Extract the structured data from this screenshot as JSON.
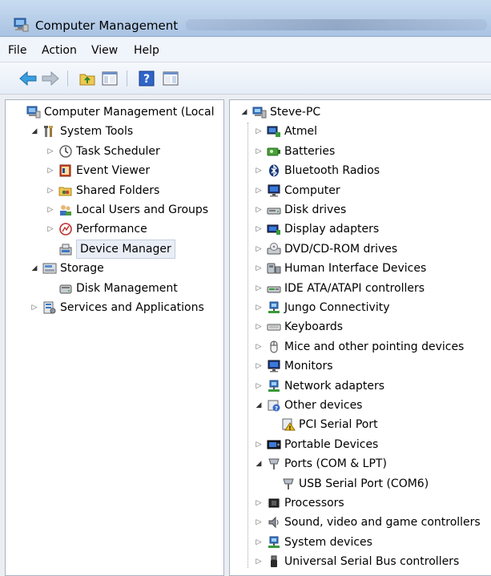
{
  "window": {
    "title": "Computer Management"
  },
  "menu": [
    "File",
    "Action",
    "View",
    "Help"
  ],
  "toolbar": {
    "buttons": [
      "back-icon",
      "forward-icon",
      "up-folder-icon",
      "show-hide-tree-icon",
      "help-icon",
      "properties-icon"
    ]
  },
  "left_tree": [
    {
      "label": "Computer Management (Local",
      "icon": "computer-management-icon",
      "level": 0,
      "expander": ""
    },
    {
      "label": "System Tools",
      "icon": "system-tools-icon",
      "level": 1,
      "expander": "open"
    },
    {
      "label": "Task Scheduler",
      "icon": "clock-icon",
      "level": 2,
      "expander": "closed"
    },
    {
      "label": "Event Viewer",
      "icon": "event-viewer-icon",
      "level": 2,
      "expander": "closed"
    },
    {
      "label": "Shared Folders",
      "icon": "shared-folders-icon",
      "level": 2,
      "expander": "closed"
    },
    {
      "label": "Local Users and Groups",
      "icon": "users-icon",
      "level": 2,
      "expander": "closed"
    },
    {
      "label": "Performance",
      "icon": "performance-icon",
      "level": 2,
      "expander": "closed"
    },
    {
      "label": "Device Manager",
      "icon": "device-manager-icon",
      "level": 2,
      "expander": "",
      "selected": true
    },
    {
      "label": "Storage",
      "icon": "storage-icon",
      "level": 1,
      "expander": "open"
    },
    {
      "label": "Disk Management",
      "icon": "disk-management-icon",
      "level": 2,
      "expander": ""
    },
    {
      "label": "Services and Applications",
      "icon": "services-icon",
      "level": 1,
      "expander": "closed"
    }
  ],
  "right_tree": [
    {
      "label": "Steve-PC",
      "icon": "computer-icon",
      "level": 0,
      "expander": "open"
    },
    {
      "label": "Atmel",
      "icon": "device-icon",
      "level": 1,
      "expander": "closed"
    },
    {
      "label": "Batteries",
      "icon": "battery-icon",
      "level": 1,
      "expander": "closed"
    },
    {
      "label": "Bluetooth Radios",
      "icon": "bluetooth-icon",
      "level": 1,
      "expander": "closed"
    },
    {
      "label": "Computer",
      "icon": "monitor-icon",
      "level": 1,
      "expander": "closed"
    },
    {
      "label": "Disk drives",
      "icon": "disk-drive-icon",
      "level": 1,
      "expander": "closed"
    },
    {
      "label": "Display adapters",
      "icon": "display-adapter-icon",
      "level": 1,
      "expander": "closed"
    },
    {
      "label": "DVD/CD-ROM drives",
      "icon": "dvd-drive-icon",
      "level": 1,
      "expander": "closed"
    },
    {
      "label": "Human Interface Devices",
      "icon": "hid-icon",
      "level": 1,
      "expander": "closed"
    },
    {
      "label": "IDE ATA/ATAPI controllers",
      "icon": "ide-controller-icon",
      "level": 1,
      "expander": "closed"
    },
    {
      "label": "Jungo Connectivity",
      "icon": "network-device-icon",
      "level": 1,
      "expander": "closed"
    },
    {
      "label": "Keyboards",
      "icon": "keyboard-icon",
      "level": 1,
      "expander": "closed"
    },
    {
      "label": "Mice and other pointing devices",
      "icon": "mouse-icon",
      "level": 1,
      "expander": "closed"
    },
    {
      "label": "Monitors",
      "icon": "monitor-icon",
      "level": 1,
      "expander": "closed"
    },
    {
      "label": "Network adapters",
      "icon": "network-adapter-icon",
      "level": 1,
      "expander": "closed"
    },
    {
      "label": "Other devices",
      "icon": "unknown-device-icon",
      "level": 1,
      "expander": "open"
    },
    {
      "label": "PCI Serial Port",
      "icon": "warning-device-icon",
      "level": 2,
      "expander": ""
    },
    {
      "label": "Portable Devices",
      "icon": "portable-device-icon",
      "level": 1,
      "expander": "closed"
    },
    {
      "label": "Ports (COM & LPT)",
      "icon": "port-icon",
      "level": 1,
      "expander": "open"
    },
    {
      "label": "USB Serial Port (COM6)",
      "icon": "port-icon",
      "level": 2,
      "expander": ""
    },
    {
      "label": "Processors",
      "icon": "processor-icon",
      "level": 1,
      "expander": "closed"
    },
    {
      "label": "Sound, video and game controllers",
      "icon": "speaker-icon",
      "level": 1,
      "expander": "closed"
    },
    {
      "label": "System devices",
      "icon": "system-device-icon",
      "level": 1,
      "expander": "closed"
    },
    {
      "label": "Universal Serial Bus controllers",
      "icon": "usb-icon",
      "level": 1,
      "expander": "closed"
    }
  ]
}
